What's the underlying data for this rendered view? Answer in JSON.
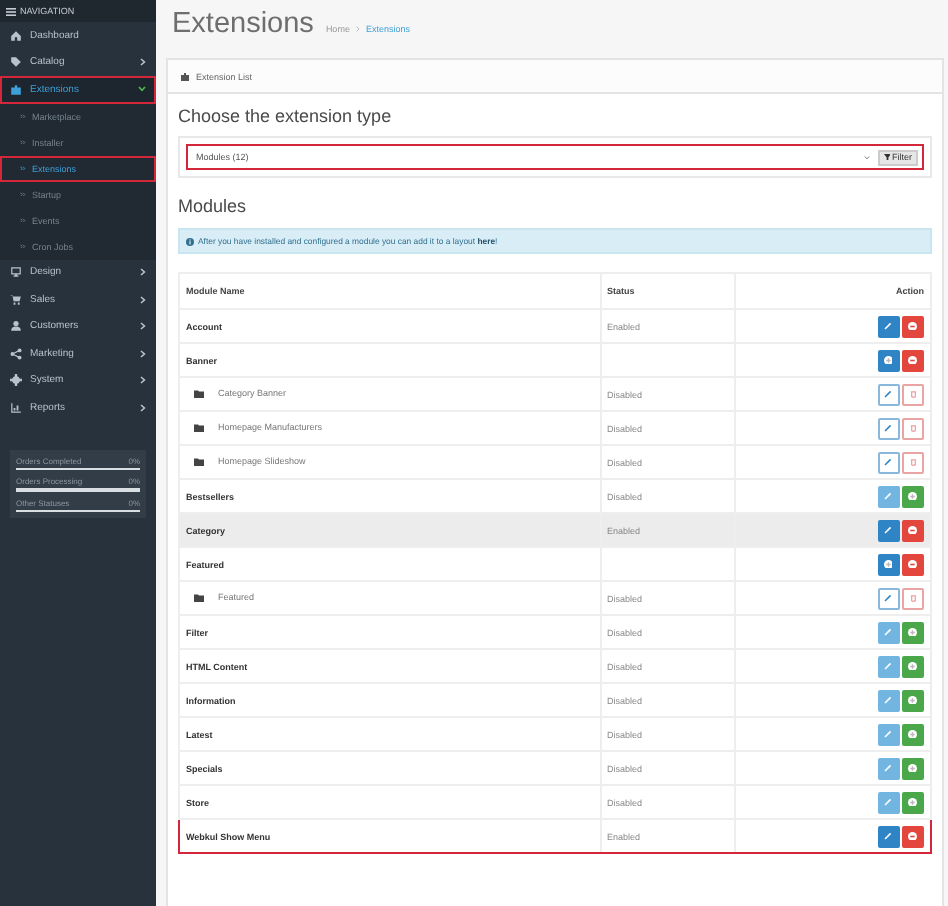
{
  "sidebar": {
    "title": "NAVIGATION",
    "items": [
      {
        "label": "Dashboard",
        "expanded": false,
        "selected": false,
        "outlined": false,
        "has_children": false
      },
      {
        "label": "Catalog",
        "expanded": false,
        "selected": false,
        "outlined": false,
        "has_children": true
      },
      {
        "label": "Extensions",
        "expanded": true,
        "selected": true,
        "outlined": true,
        "has_children": true,
        "children": [
          {
            "label": "Marketplace",
            "selected": false,
            "outlined": false
          },
          {
            "label": "Installer",
            "selected": false,
            "outlined": false
          },
          {
            "label": "Extensions",
            "selected": true,
            "outlined": true
          },
          {
            "label": "Startup",
            "selected": false,
            "outlined": false
          },
          {
            "label": "Events",
            "selected": false,
            "outlined": false
          },
          {
            "label": "Cron Jobs",
            "selected": false,
            "outlined": false
          }
        ]
      },
      {
        "label": "Design",
        "expanded": false,
        "selected": false,
        "outlined": false,
        "has_children": true
      },
      {
        "label": "Sales",
        "expanded": false,
        "selected": false,
        "outlined": false,
        "has_children": true
      },
      {
        "label": "Customers",
        "expanded": false,
        "selected": false,
        "outlined": false,
        "has_children": true
      },
      {
        "label": "Marketing",
        "expanded": false,
        "selected": false,
        "outlined": false,
        "has_children": true
      },
      {
        "label": "System",
        "expanded": false,
        "selected": false,
        "outlined": false,
        "has_children": true
      },
      {
        "label": "Reports",
        "expanded": false,
        "selected": false,
        "outlined": false,
        "has_children": true
      }
    ],
    "stats": [
      {
        "label": "Orders Completed",
        "reading": "0%",
        "level": 0
      },
      {
        "label": "Orders Processing",
        "reading": "0%",
        "level": 0
      },
      {
        "label": "Other Statuses",
        "reading": "0%",
        "level": 0
      }
    ]
  },
  "page": {
    "title": "Extensions",
    "breadcrumb": [
      "Home",
      "Extensions"
    ]
  },
  "panel": {
    "heading": "Extension List",
    "choose_title": "Choose the extension type",
    "select": {
      "value": "Modules (12)",
      "outlined": true
    },
    "filter_button": "Filter",
    "section_title": "Modules",
    "alert": {
      "text": "After you have installed and configured a module you can add it to a layout ",
      "link": "here",
      "after": "!"
    }
  },
  "table": {
    "columns": [
      "Module Name",
      "Status",
      "Action"
    ],
    "rows": [
      {
        "name": "Account",
        "kind": "module",
        "status": "Enabled",
        "highlighted": false,
        "outlined": false,
        "actions": [
          {
            "kind": "edit"
          },
          {
            "kind": "uninstall"
          }
        ]
      },
      {
        "name": "Banner",
        "kind": "module",
        "status": "",
        "highlighted": false,
        "outlined": false,
        "actions": [
          {
            "kind": "add"
          },
          {
            "kind": "uninstall"
          }
        ]
      },
      {
        "name": "Category Banner",
        "kind": "child",
        "status": "Disabled",
        "highlighted": false,
        "outlined": false,
        "actions": [
          {
            "kind": "edit-outline"
          },
          {
            "kind": "delete-outline"
          }
        ]
      },
      {
        "name": "Homepage Manufacturers",
        "kind": "child",
        "status": "Disabled",
        "highlighted": false,
        "outlined": false,
        "actions": [
          {
            "kind": "edit-outline"
          },
          {
            "kind": "delete-outline"
          }
        ]
      },
      {
        "name": "Homepage Slideshow",
        "kind": "child",
        "status": "Disabled",
        "highlighted": false,
        "outlined": false,
        "actions": [
          {
            "kind": "edit-outline"
          },
          {
            "kind": "delete-outline"
          }
        ]
      },
      {
        "name": "Bestsellers",
        "kind": "module",
        "status": "Disabled",
        "highlighted": false,
        "outlined": false,
        "actions": [
          {
            "kind": "edit-disabled"
          },
          {
            "kind": "install"
          }
        ]
      },
      {
        "name": "Category",
        "kind": "module",
        "status": "Enabled",
        "highlighted": true,
        "outlined": false,
        "actions": [
          {
            "kind": "edit"
          },
          {
            "kind": "uninstall"
          }
        ]
      },
      {
        "name": "Featured",
        "kind": "module",
        "status": "",
        "highlighted": false,
        "outlined": false,
        "actions": [
          {
            "kind": "add"
          },
          {
            "kind": "uninstall"
          }
        ]
      },
      {
        "name": "Featured",
        "kind": "child",
        "status": "Disabled",
        "highlighted": false,
        "outlined": false,
        "actions": [
          {
            "kind": "edit-outline"
          },
          {
            "kind": "delete-outline"
          }
        ]
      },
      {
        "name": "Filter",
        "kind": "module",
        "status": "Disabled",
        "highlighted": false,
        "outlined": false,
        "actions": [
          {
            "kind": "edit-disabled"
          },
          {
            "kind": "install"
          }
        ]
      },
      {
        "name": "HTML Content",
        "kind": "module",
        "status": "Disabled",
        "highlighted": false,
        "outlined": false,
        "actions": [
          {
            "kind": "edit-disabled"
          },
          {
            "kind": "install"
          }
        ]
      },
      {
        "name": "Information",
        "kind": "module",
        "status": "Disabled",
        "highlighted": false,
        "outlined": false,
        "actions": [
          {
            "kind": "edit-disabled"
          },
          {
            "kind": "install"
          }
        ]
      },
      {
        "name": "Latest",
        "kind": "module",
        "status": "Disabled",
        "highlighted": false,
        "outlined": false,
        "actions": [
          {
            "kind": "edit-disabled"
          },
          {
            "kind": "install"
          }
        ]
      },
      {
        "name": "Specials",
        "kind": "module",
        "status": "Disabled",
        "highlighted": false,
        "outlined": false,
        "actions": [
          {
            "kind": "edit-disabled"
          },
          {
            "kind": "install"
          }
        ]
      },
      {
        "name": "Store",
        "kind": "module",
        "status": "Disabled",
        "highlighted": false,
        "outlined": false,
        "actions": [
          {
            "kind": "edit-disabled"
          },
          {
            "kind": "install"
          }
        ]
      },
      {
        "name": "Webkul Show Menu",
        "kind": "module",
        "status": "Enabled",
        "highlighted": false,
        "outlined": true,
        "actions": [
          {
            "kind": "edit"
          },
          {
            "kind": "uninstall"
          }
        ]
      }
    ]
  }
}
